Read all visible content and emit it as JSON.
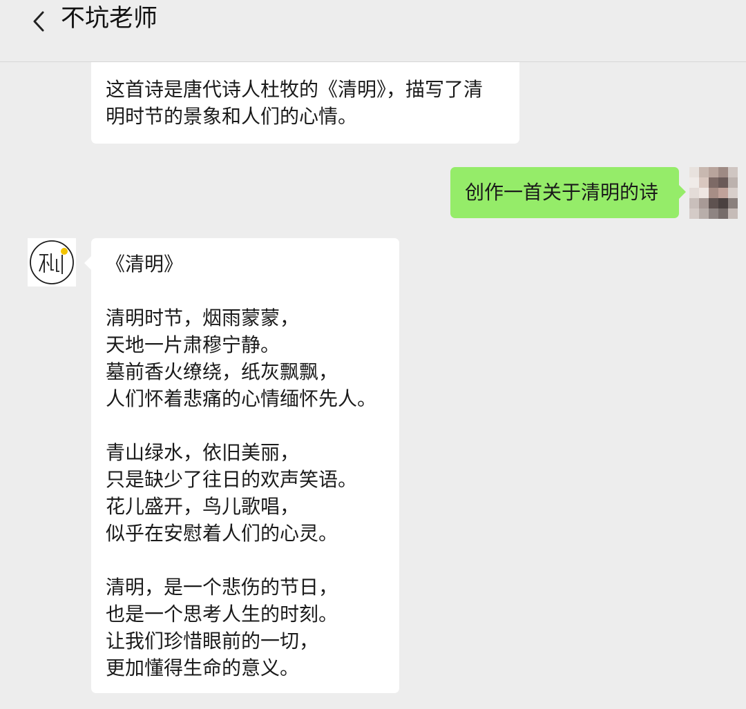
{
  "header": {
    "title": "不坑老师",
    "back_icon": "chevron-left-icon"
  },
  "messages": {
    "previous": {
      "line1": "这首诗是唐代诗人杜牧的《清明》，描写了清",
      "line2": "明时节的景象和人们的心情。"
    },
    "user": {
      "text": "创作一首关于清明的诗",
      "bubble_color": "#95ec69"
    },
    "reply": {
      "title": "《清明》",
      "stanzas": [
        [
          "清明时节，烟雨蒙蒙，",
          "天地一片肃穆宁静。",
          "墓前香火缭绕，纸灰飘飘，",
          "人们怀着悲痛的心情缅怀先人。"
        ],
        [
          "青山绿水，依旧美丽，",
          "只是缺少了往日的欢声笑语。",
          "花儿盛开，鸟儿歌唱，",
          "似乎在安慰着人们的心灵。"
        ],
        [
          "清明，是一个悲伤的节日，",
          "也是一个思考人生的时刻。",
          "让我们珍惜眼前的一切，",
          "更加懂得生命的意义。"
        ]
      ]
    }
  },
  "colors": {
    "background": "#ededed",
    "bubble_white": "#ffffff",
    "bubble_green": "#95ec69",
    "logo_accent": "#f2c300"
  }
}
